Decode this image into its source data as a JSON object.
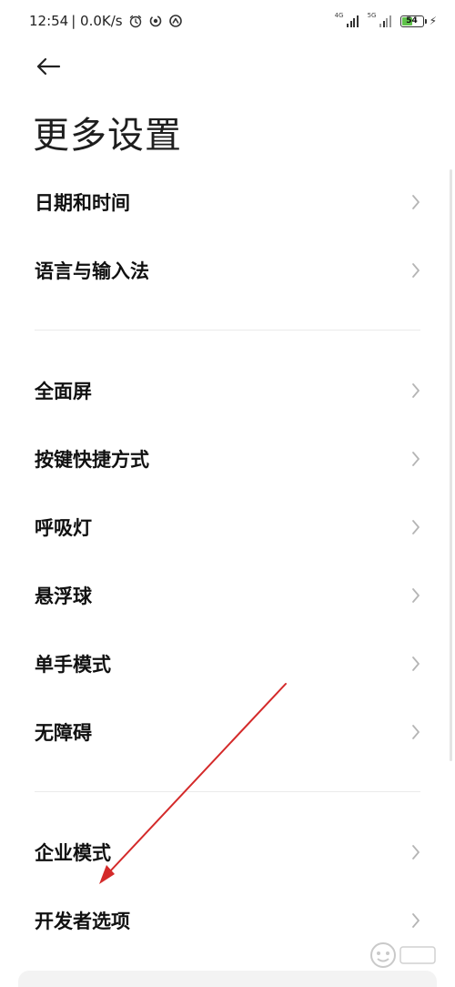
{
  "status_bar": {
    "time": "12:54",
    "network_speed": "| 0.0K/s",
    "icons": [
      "alarm-icon",
      "notification-swirl-icon",
      "speed-ring-icon"
    ],
    "sim1_label": "4G",
    "sim2_label": "5G",
    "battery_level": "54",
    "battery_fraction": 0.54,
    "charging": true
  },
  "header": {
    "title": "更多设置",
    "back_icon": "back-arrow-icon"
  },
  "groups": [
    {
      "items": [
        {
          "label": "日期和时间"
        },
        {
          "label": "语言与输入法"
        }
      ]
    },
    {
      "items": [
        {
          "label": "全面屏"
        },
        {
          "label": "按键快捷方式"
        },
        {
          "label": "呼吸灯"
        },
        {
          "label": "悬浮球"
        },
        {
          "label": "单手模式"
        },
        {
          "label": "无障碍"
        }
      ]
    },
    {
      "items": [
        {
          "label": "企业模式"
        },
        {
          "label": "开发者选项"
        }
      ]
    }
  ],
  "colors": {
    "text": "#111111",
    "chevron": "#b5b5b5",
    "divider": "#ebebeb",
    "annotation_arrow": "#d42a2a"
  }
}
